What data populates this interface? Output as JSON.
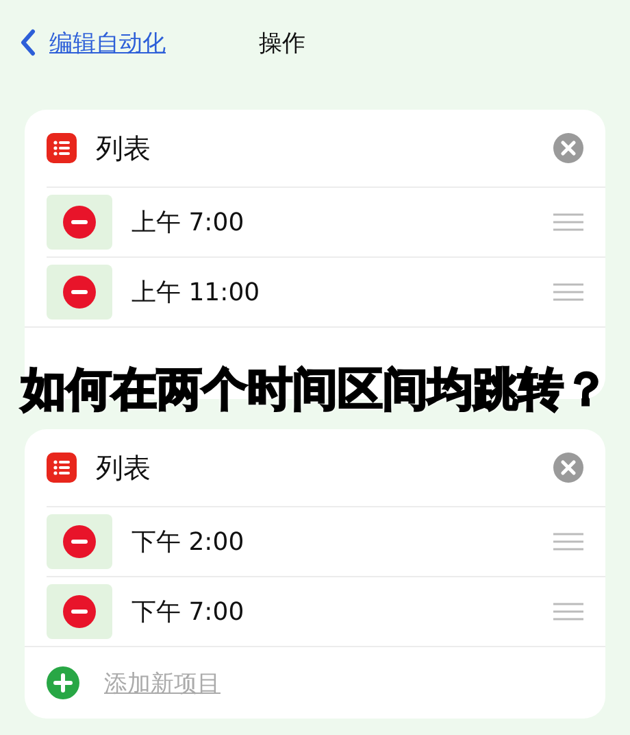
{
  "nav": {
    "back": "编辑自动化",
    "title": "操作"
  },
  "cards": [
    {
      "title": "列表",
      "items": [
        {
          "text": "上午 7:00"
        },
        {
          "text": "上午 11:00"
        }
      ]
    },
    {
      "title": "列表",
      "items": [
        {
          "text": "下午 2:00"
        },
        {
          "text": "下午 7:00"
        }
      ],
      "add_label": "添加新项目"
    }
  ],
  "caption": "如何在两个时间区间均跳转？"
}
